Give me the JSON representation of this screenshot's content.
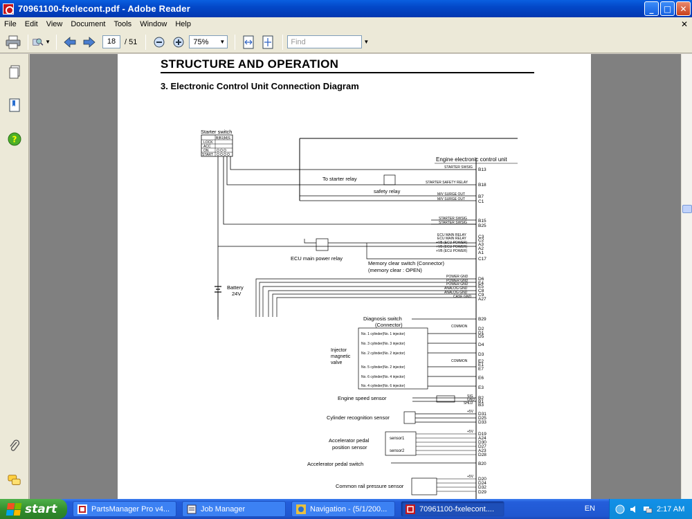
{
  "window": {
    "title": "70961100-fxelecont.pdf - Adobe Reader",
    "minimize": "_",
    "maximize": "□",
    "close": "✕"
  },
  "menu": [
    "File",
    "Edit",
    "View",
    "Document",
    "Tools",
    "Window",
    "Help"
  ],
  "menu_close": "✕",
  "toolbar": {
    "page_current": "18",
    "page_total": "/ 51",
    "zoom": "75%",
    "find_placeholder": "Find"
  },
  "document": {
    "section_title": "STRUCTURE AND OPERATION",
    "subsection_title": "3.  Electronic Control Unit Connection Diagram",
    "diagram_labels": {
      "starter_switch": "Starter switch",
      "ecu": "Engine electronic control unit",
      "to_starter_relay": "To starter relay",
      "safety_relay": "safety relay",
      "ecu_main_power_relay": "ECU main power relay",
      "memory_clear_switch": "Memory clear switch (Connector)",
      "memory_clear_open": "(memory clear : OPEN)",
      "battery": "Battery",
      "battery_v": "24V",
      "diagnosis_switch": "Diagnosis switch",
      "diagnosis_connector": "(Connector)",
      "injector": "Injector",
      "magnetic": "magnetic",
      "valve": "valve",
      "engine_speed_sensor": "Engine speed sensor",
      "cylinder_recognition_sensor": "Cylinder recognition sensor",
      "accel_pedal_pos_1": "Accelerator pedal",
      "accel_pedal_pos_2": "position sensor",
      "sensor1": "sensor1",
      "sensor2": "sensor2",
      "accel_pedal_switch": "Accelerator pedal switch",
      "common_rail_pressure_sensor": "Common rail pressure sensor"
    },
    "switch_table": [
      "LOCK",
      "ACC",
      "ON",
      "START"
    ],
    "switch_table_header": "B|B1|M|S",
    "pins_top": [
      {
        "sig": "STARTER SWSIG",
        "pin": "B13"
      },
      {
        "sig": "STARTER SAFETY RELAY",
        "pin": "B18"
      },
      {
        "sig": "M/V SURGE OUT",
        "pin": "B7"
      },
      {
        "sig": "M/V SURGE OUT",
        "pin": "C1"
      },
      {
        "sig": "STARTER SWSIG",
        "pin": "B15"
      },
      {
        "sig": "STARTER SWSIG",
        "pin": "B25"
      },
      {
        "sig": "ECU MAIN RELAY",
        "pin": "C3"
      },
      {
        "sig": "ECU MAIN RELAY",
        "pin": "C2"
      },
      {
        "sig": "+VB (ECU POWER)",
        "pin": "A3"
      },
      {
        "sig": "+VB (ECU POWER)",
        "pin": "A2"
      },
      {
        "sig": "+VB (ECU POWER)",
        "pin": "A1"
      },
      {
        "sig": "",
        "pin": "C17"
      },
      {
        "sig": "POWER GND",
        "pin": "D6"
      },
      {
        "sig": "POWER GND",
        "pin": "E4"
      },
      {
        "sig": "POWER GND",
        "pin": "E5"
      },
      {
        "sig": "ANALOG GND",
        "pin": "C8"
      },
      {
        "sig": "ANALOG GND",
        "pin": "C9"
      },
      {
        "sig": "CASE GND",
        "pin": "A27"
      }
    ],
    "injector_rows": [
      {
        "label": "No. 1 cylinder(No. 1 injector)",
        "pin": "D1"
      },
      {
        "label": "No. 3 cylinder(No. 3 injector)",
        "pin": "D4"
      },
      {
        "label": "No. 2 cylinder(No. 2 injector)",
        "pin": "D3"
      },
      {
        "label": "No. 5 cylinder(No. 2 injector)",
        "pin": "E7"
      },
      {
        "label": "No. 6 cylinder(No. 4 injector)",
        "pin": "E6"
      },
      {
        "label": "No. 4 cylinder(No. 6 injector)",
        "pin": "E3"
      }
    ],
    "common_labels": {
      "common": "COMMON"
    },
    "misc_pins": {
      "b29": "B29",
      "d2": "D2",
      "d5": "D5",
      "e2": "E2",
      "e1": "E1",
      "b2": "B2",
      "b1": "B1",
      "b3": "B3",
      "sig": "SIG",
      "gnd": "GND",
      "shld": "SHLD",
      "d31": "D31",
      "d25": "D25",
      "d33": "D33",
      "v5": "+5V",
      "d19": "D19",
      "a24": "A24",
      "d30": "D30",
      "d27": "D27",
      "a23": "A23",
      "d28": "D28",
      "b20": "B20",
      "d20": "D20",
      "d24": "D24",
      "d32": "D32",
      "d29": "D29"
    }
  },
  "taskbar": {
    "start": "start",
    "tasks": [
      "PartsManager Pro v4...",
      "Job Manager",
      "Navigation - (5/1/200...",
      "70961100-fxelecont...."
    ],
    "lang": "EN",
    "time": "2:17 AM"
  }
}
